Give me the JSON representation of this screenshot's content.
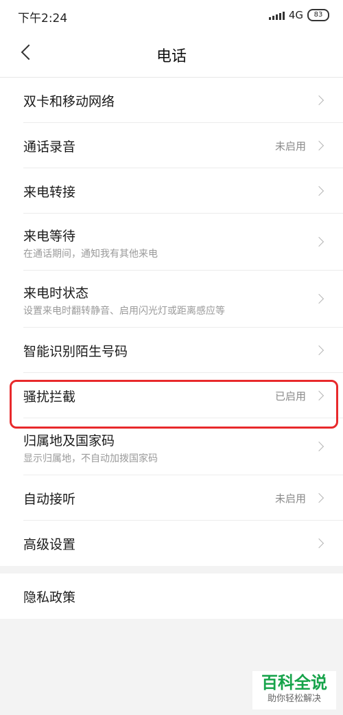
{
  "status_bar": {
    "time": "下午2:24",
    "network": "4G",
    "battery": "83"
  },
  "header": {
    "title": "电话"
  },
  "settings": [
    {
      "label": "双卡和移动网络",
      "subtitle": "",
      "value": ""
    },
    {
      "label": "通话录音",
      "subtitle": "",
      "value": "未启用"
    },
    {
      "label": "来电转接",
      "subtitle": "",
      "value": ""
    },
    {
      "label": "来电等待",
      "subtitle": "在通话期间，通知我有其他来电",
      "value": ""
    },
    {
      "label": "来电时状态",
      "subtitle": "设置来电时翻转静音、启用闪光灯或距离感应等",
      "value": ""
    },
    {
      "label": "智能识别陌生号码",
      "subtitle": "",
      "value": ""
    },
    {
      "label": "骚扰拦截",
      "subtitle": "",
      "value": "已启用"
    },
    {
      "label": "归属地及国家码",
      "subtitle": "显示归属地，不自动加拨国家码",
      "value": ""
    },
    {
      "label": "自动接听",
      "subtitle": "",
      "value": "未启用"
    },
    {
      "label": "高级设置",
      "subtitle": "",
      "value": ""
    }
  ],
  "privacy": {
    "label": "隐私政策"
  },
  "watermark": {
    "main": "百科全说",
    "sub": "助你轻松解决"
  },
  "colors": {
    "highlight": "#e8292b",
    "watermark": "#16a34a"
  }
}
